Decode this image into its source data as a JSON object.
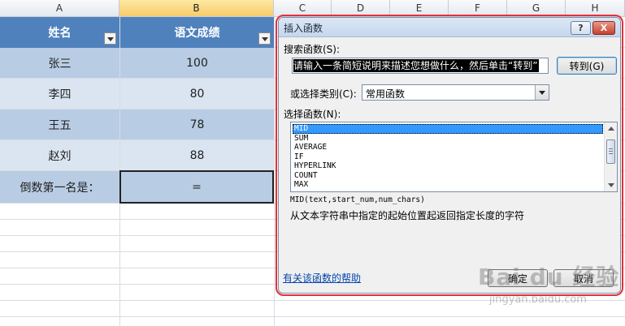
{
  "spreadsheet": {
    "columns": [
      "A",
      "B",
      "C",
      "D",
      "E",
      "F",
      "G",
      "H"
    ],
    "header_row": {
      "name_label": "姓名",
      "score_label": "语文成绩"
    },
    "rows": [
      {
        "name": "张三",
        "score": "100"
      },
      {
        "name": "李四",
        "score": "80"
      },
      {
        "name": "王五",
        "score": "78"
      },
      {
        "name": "赵刘",
        "score": "88"
      }
    ],
    "result_label": "倒数第一名是：",
    "result_formula": "="
  },
  "dialog": {
    "title": "插入函数",
    "help_button": "?",
    "close_button": "X",
    "search_label": "搜索函数(S):",
    "search_value": "请输入一条简短说明来描述您想做什么，然后单击“转到”",
    "goto_button": "转到(G)",
    "category_label": "或选择类别(C):",
    "category_value": "常用函数",
    "function_list_label": "选择函数(N):",
    "functions": [
      "MID",
      "SUM",
      "AVERAGE",
      "IF",
      "HYPERLINK",
      "COUNT",
      "MAX"
    ],
    "selected_function": "MID",
    "signature": "MID(text,start_num,num_chars)",
    "description": "从文本字符串中指定的起始位置起返回指定长度的字符",
    "help_link": "有关该函数的帮助",
    "ok_button": "确定",
    "cancel_button": "取消"
  },
  "watermark": {
    "logo": "Bai du 经验",
    "url": "jingyan.baidu.com"
  },
  "colors": {
    "header_blue": "#4f81bd",
    "band_dark": "#b8cce4",
    "band_light": "#dbe5f1",
    "highlight_ring": "#e0313a",
    "selection": "#3399ff"
  }
}
